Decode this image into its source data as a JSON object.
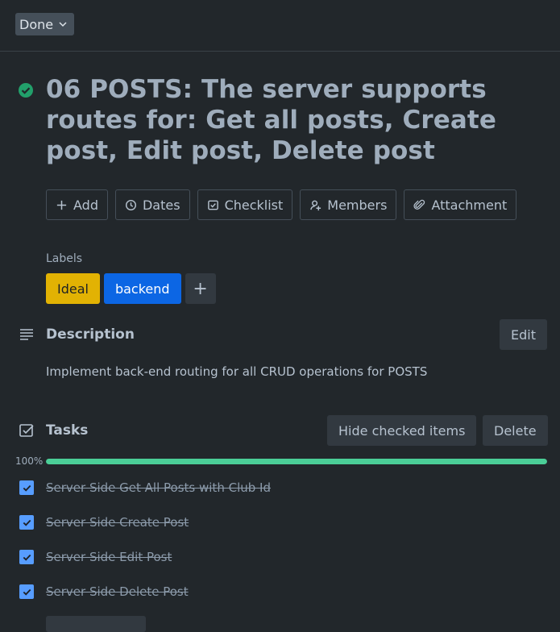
{
  "header": {
    "status_label": "Done"
  },
  "card": {
    "title": "06 POSTS: The server supports routes for: Get all posts, Create post, Edit post, Delete post"
  },
  "actions": [
    {
      "label": "Add",
      "icon": "plus-icon"
    },
    {
      "label": "Dates",
      "icon": "clock-icon"
    },
    {
      "label": "Checklist",
      "icon": "checklist-icon"
    },
    {
      "label": "Members",
      "icon": "add-member-icon"
    },
    {
      "label": "Attachment",
      "icon": "paperclip-icon"
    }
  ],
  "labels": {
    "heading": "Labels",
    "items": [
      {
        "text": "Ideal",
        "color": "#e2b203"
      },
      {
        "text": "backend",
        "color": "#0c66e4"
      }
    ],
    "add_symbol": "+"
  },
  "description": {
    "heading": "Description",
    "edit_label": "Edit",
    "text": "Implement back-end routing for all CRUD operations for POSTS"
  },
  "checklist": {
    "heading": "Tasks",
    "hide_label": "Hide checked items",
    "delete_label": "Delete",
    "progress_text": "100%",
    "progress_value": 1.0,
    "items": [
      {
        "text": "Server Side Get All Posts with Club Id",
        "checked": true
      },
      {
        "text": "Server  Side Create Post",
        "checked": true
      },
      {
        "text": "Server Side Edit Post",
        "checked": true
      },
      {
        "text": "Server Side Delete Post",
        "checked": true
      }
    ]
  },
  "colors": {
    "background": "#22272b",
    "progress": "#4bce97",
    "checkbox": "#579dff"
  }
}
